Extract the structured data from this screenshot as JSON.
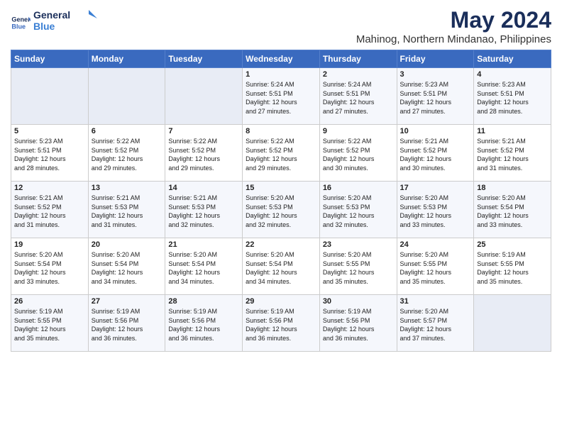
{
  "logo": {
    "line1": "General",
    "line2": "Blue"
  },
  "title": "May 2024",
  "subtitle": "Mahinog, Northern Mindanao, Philippines",
  "days_header": [
    "Sunday",
    "Monday",
    "Tuesday",
    "Wednesday",
    "Thursday",
    "Friday",
    "Saturday"
  ],
  "weeks": [
    [
      {
        "day": "",
        "info": ""
      },
      {
        "day": "",
        "info": ""
      },
      {
        "day": "",
        "info": ""
      },
      {
        "day": "1",
        "info": "Sunrise: 5:24 AM\nSunset: 5:51 PM\nDaylight: 12 hours\nand 27 minutes."
      },
      {
        "day": "2",
        "info": "Sunrise: 5:24 AM\nSunset: 5:51 PM\nDaylight: 12 hours\nand 27 minutes."
      },
      {
        "day": "3",
        "info": "Sunrise: 5:23 AM\nSunset: 5:51 PM\nDaylight: 12 hours\nand 27 minutes."
      },
      {
        "day": "4",
        "info": "Sunrise: 5:23 AM\nSunset: 5:51 PM\nDaylight: 12 hours\nand 28 minutes."
      }
    ],
    [
      {
        "day": "5",
        "info": "Sunrise: 5:23 AM\nSunset: 5:51 PM\nDaylight: 12 hours\nand 28 minutes."
      },
      {
        "day": "6",
        "info": "Sunrise: 5:22 AM\nSunset: 5:52 PM\nDaylight: 12 hours\nand 29 minutes."
      },
      {
        "day": "7",
        "info": "Sunrise: 5:22 AM\nSunset: 5:52 PM\nDaylight: 12 hours\nand 29 minutes."
      },
      {
        "day": "8",
        "info": "Sunrise: 5:22 AM\nSunset: 5:52 PM\nDaylight: 12 hours\nand 29 minutes."
      },
      {
        "day": "9",
        "info": "Sunrise: 5:22 AM\nSunset: 5:52 PM\nDaylight: 12 hours\nand 30 minutes."
      },
      {
        "day": "10",
        "info": "Sunrise: 5:21 AM\nSunset: 5:52 PM\nDaylight: 12 hours\nand 30 minutes."
      },
      {
        "day": "11",
        "info": "Sunrise: 5:21 AM\nSunset: 5:52 PM\nDaylight: 12 hours\nand 31 minutes."
      }
    ],
    [
      {
        "day": "12",
        "info": "Sunrise: 5:21 AM\nSunset: 5:52 PM\nDaylight: 12 hours\nand 31 minutes."
      },
      {
        "day": "13",
        "info": "Sunrise: 5:21 AM\nSunset: 5:53 PM\nDaylight: 12 hours\nand 31 minutes."
      },
      {
        "day": "14",
        "info": "Sunrise: 5:21 AM\nSunset: 5:53 PM\nDaylight: 12 hours\nand 32 minutes."
      },
      {
        "day": "15",
        "info": "Sunrise: 5:20 AM\nSunset: 5:53 PM\nDaylight: 12 hours\nand 32 minutes."
      },
      {
        "day": "16",
        "info": "Sunrise: 5:20 AM\nSunset: 5:53 PM\nDaylight: 12 hours\nand 32 minutes."
      },
      {
        "day": "17",
        "info": "Sunrise: 5:20 AM\nSunset: 5:53 PM\nDaylight: 12 hours\nand 33 minutes."
      },
      {
        "day": "18",
        "info": "Sunrise: 5:20 AM\nSunset: 5:54 PM\nDaylight: 12 hours\nand 33 minutes."
      }
    ],
    [
      {
        "day": "19",
        "info": "Sunrise: 5:20 AM\nSunset: 5:54 PM\nDaylight: 12 hours\nand 33 minutes."
      },
      {
        "day": "20",
        "info": "Sunrise: 5:20 AM\nSunset: 5:54 PM\nDaylight: 12 hours\nand 34 minutes."
      },
      {
        "day": "21",
        "info": "Sunrise: 5:20 AM\nSunset: 5:54 PM\nDaylight: 12 hours\nand 34 minutes."
      },
      {
        "day": "22",
        "info": "Sunrise: 5:20 AM\nSunset: 5:54 PM\nDaylight: 12 hours\nand 34 minutes."
      },
      {
        "day": "23",
        "info": "Sunrise: 5:20 AM\nSunset: 5:55 PM\nDaylight: 12 hours\nand 35 minutes."
      },
      {
        "day": "24",
        "info": "Sunrise: 5:20 AM\nSunset: 5:55 PM\nDaylight: 12 hours\nand 35 minutes."
      },
      {
        "day": "25",
        "info": "Sunrise: 5:19 AM\nSunset: 5:55 PM\nDaylight: 12 hours\nand 35 minutes."
      }
    ],
    [
      {
        "day": "26",
        "info": "Sunrise: 5:19 AM\nSunset: 5:55 PM\nDaylight: 12 hours\nand 35 minutes."
      },
      {
        "day": "27",
        "info": "Sunrise: 5:19 AM\nSunset: 5:56 PM\nDaylight: 12 hours\nand 36 minutes."
      },
      {
        "day": "28",
        "info": "Sunrise: 5:19 AM\nSunset: 5:56 PM\nDaylight: 12 hours\nand 36 minutes."
      },
      {
        "day": "29",
        "info": "Sunrise: 5:19 AM\nSunset: 5:56 PM\nDaylight: 12 hours\nand 36 minutes."
      },
      {
        "day": "30",
        "info": "Sunrise: 5:19 AM\nSunset: 5:56 PM\nDaylight: 12 hours\nand 36 minutes."
      },
      {
        "day": "31",
        "info": "Sunrise: 5:20 AM\nSunset: 5:57 PM\nDaylight: 12 hours\nand 37 minutes."
      },
      {
        "day": "",
        "info": ""
      }
    ]
  ]
}
